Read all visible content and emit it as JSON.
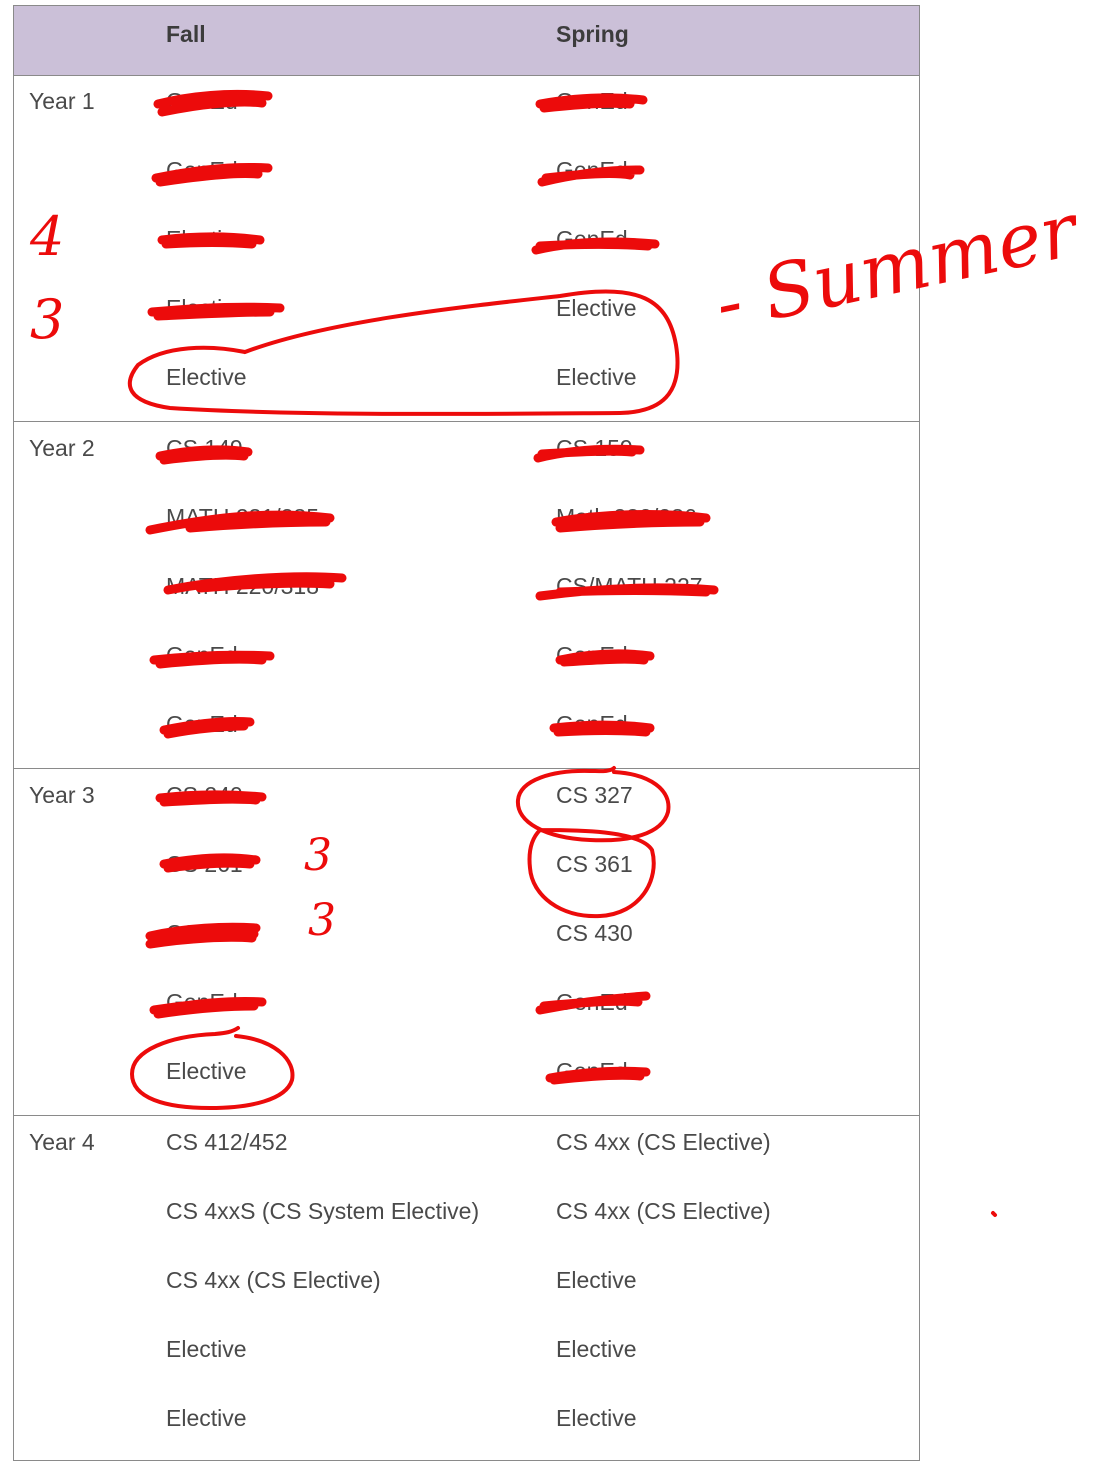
{
  "header": {
    "fall": "Fall",
    "spring": "Spring"
  },
  "years": [
    {
      "label": "Year 1",
      "fall": [
        "GenEd",
        "GenEd",
        "Elective",
        "Elective",
        "Elective"
      ],
      "spring": [
        "GenEd",
        "GenEd",
        "GenEd",
        "Elective",
        "Elective"
      ]
    },
    {
      "label": "Year 2",
      "fall": [
        "CS 149",
        "MATH 231/235",
        "MATH 220/318",
        "GenEd",
        "GenEd"
      ],
      "spring": [
        "CS 159",
        "Math 232/236",
        "CS/MATH 227",
        "GenEd",
        "GenEd"
      ]
    },
    {
      "label": "Year 3",
      "fall": [
        "CS 240",
        "CS 261",
        "CS 345",
        "GenEd",
        "Elective"
      ],
      "spring": [
        "CS 327",
        "CS 361",
        "CS 430",
        "GenEd",
        "GenEd"
      ]
    },
    {
      "label": "Year 4",
      "fall": [
        "CS 412/452",
        "CS 4xxS (CS System Elective)",
        "CS 4xx (CS Elective)",
        "Elective",
        "Elective"
      ],
      "spring": [
        "CS 4xx (CS Elective)",
        "CS 4xx (CS Elective)",
        "Elective",
        "Elective",
        "Elective"
      ]
    }
  ],
  "annotations": {
    "summer_note": "- Summer",
    "year1_num_a": "4",
    "year1_num_b": "3",
    "year3_num_a": "3",
    "year3_num_b": "3",
    "ink_color": "#ec0b0b"
  }
}
